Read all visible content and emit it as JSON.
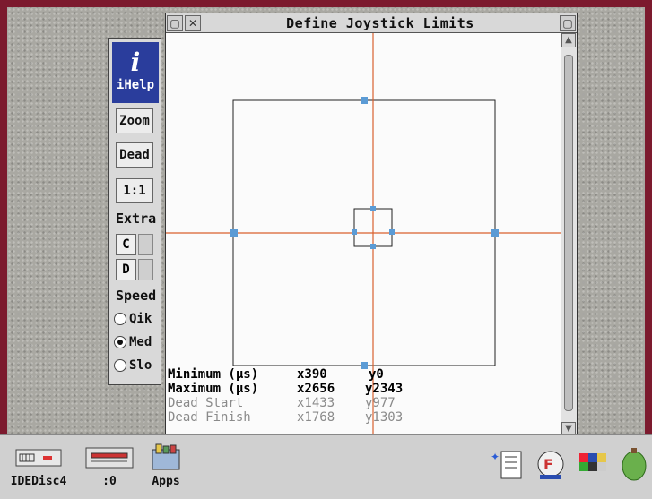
{
  "window": {
    "title": "Define Joystick Limits"
  },
  "toolbox": {
    "ihelp_label": "iHelp",
    "zoom_label": "Zoom",
    "dead_label": "Dead",
    "one_to_one_label": "1:1",
    "extra_label": "Extra",
    "c_label": "C",
    "d_label": "D",
    "speed_label": "Speed",
    "speed_options": [
      {
        "label": "Qik",
        "selected": false
      },
      {
        "label": "Med",
        "selected": true
      },
      {
        "label": "Slo",
        "selected": false
      }
    ]
  },
  "readouts": {
    "minimum": {
      "label": "Minimum (µs)",
      "x": "x390",
      "y": "y0"
    },
    "maximum": {
      "label": "Maximum (µs)",
      "x": "x2656",
      "y": "y2343"
    },
    "dead_start": {
      "label": "Dead Start",
      "x": "x1433",
      "y": "y977"
    },
    "dead_finish": {
      "label": "Dead Finish",
      "x": "x1768",
      "y": "y1303"
    }
  },
  "iconbar": {
    "items": [
      {
        "name": "drive-icon",
        "label": "IDEDisc4"
      },
      {
        "name": "ram-disc-icon",
        "label": ":0"
      },
      {
        "name": "apps-icon",
        "label": "Apps"
      }
    ]
  },
  "colors": {
    "crosshair": "#d9602e",
    "handle": "#5b9bd5",
    "titlebar": "#d8d8d8",
    "desktop_border": "#7c1a2e",
    "ihelp_bg": "#2a3d9c"
  }
}
